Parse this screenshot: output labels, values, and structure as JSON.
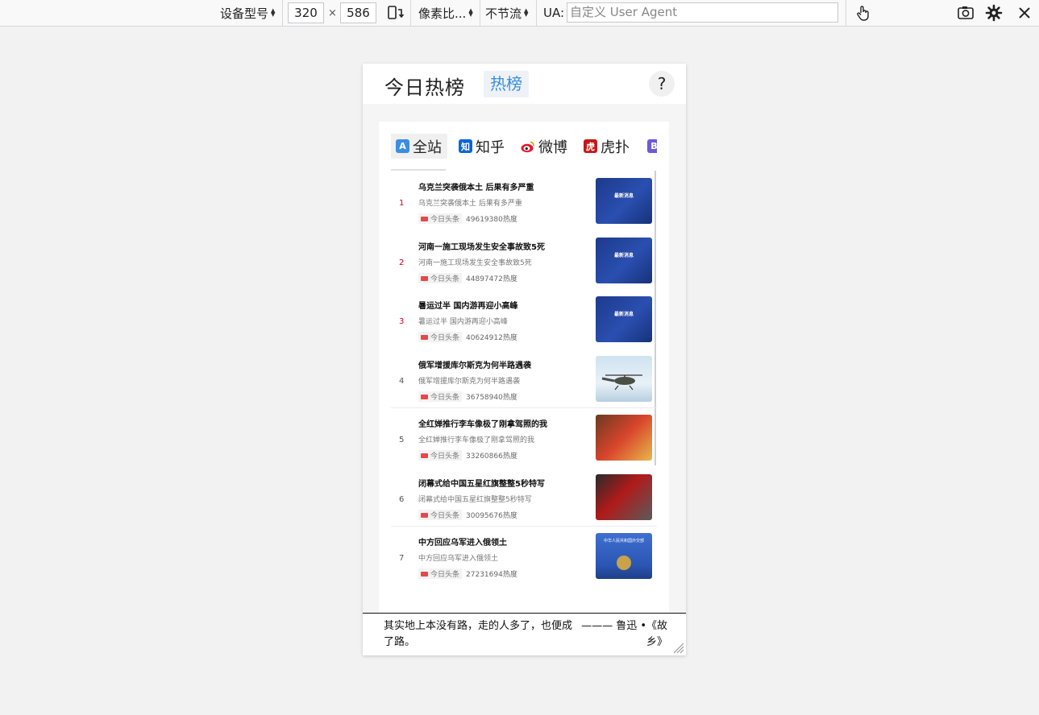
{
  "toolbar": {
    "device_select": "设备型号",
    "width": "320",
    "times": "×",
    "height": "586",
    "pixel_ratio": "像素比...",
    "throttle": "不节流",
    "ua_label": "UA:",
    "ua_placeholder": "自定义 User Agent"
  },
  "app": {
    "title": "今日热榜",
    "badge": "热榜",
    "help": "?"
  },
  "tabs": [
    {
      "label": "全站",
      "logo": "A",
      "color": "#3b8ee0"
    },
    {
      "label": "知乎",
      "logo": "知",
      "color": "#0a66d8"
    },
    {
      "label": "微博",
      "logo": "",
      "color": "#e6162d"
    },
    {
      "label": "虎扑",
      "logo": "虎",
      "color": "#c21a1a"
    },
    {
      "label": "",
      "logo": "B",
      "color": "#6b5bd6"
    }
  ],
  "items": [
    {
      "rank": "1",
      "title": "乌克兰突袭俄本土 后果有多严重",
      "desc": "乌克兰突袭俄本土 后果有多严重",
      "source": "今日头条",
      "heat": "49619380热度",
      "thumb_text": "最新消息"
    },
    {
      "rank": "2",
      "title": "河南一施工现场发生安全事故致5死",
      "desc": "河南一施工现场发生安全事故致5死",
      "source": "今日头条",
      "heat": "44897472热度",
      "thumb_text": "最新消息"
    },
    {
      "rank": "3",
      "title": "暑运过半 国内游再迎小高峰",
      "desc": "暑运过半 国内游再迎小高峰",
      "source": "今日头条",
      "heat": "40624912热度",
      "thumb_text": "最新消息"
    },
    {
      "rank": "4",
      "title": "俄军增援库尔斯克为何半路遇袭",
      "desc": "俄军增援库尔斯克为何半路遇袭",
      "source": "今日头条",
      "heat": "36758940热度",
      "thumb_text": ""
    },
    {
      "rank": "5",
      "title": "全红婵推行李车像极了刚拿驾照的我",
      "desc": "全红婵推行李车像极了刚拿驾照的我",
      "source": "今日头条",
      "heat": "33260866热度",
      "thumb_text": ""
    },
    {
      "rank": "6",
      "title": "闭幕式给中国五星红旗整整5秒特写",
      "desc": "闭幕式给中国五星红旗整整5秒特写",
      "source": "今日头条",
      "heat": "30095676热度",
      "thumb_text": ""
    },
    {
      "rank": "7",
      "title": "中方回应乌军进入俄领土",
      "desc": "中方回应乌军进入俄领土",
      "source": "今日头条",
      "heat": "27231694热度",
      "thumb_text": "中华人民共和国外交部"
    }
  ],
  "quote": {
    "text": "其实地上本没有路，走的人多了，也便成了路。",
    "author": "——— 鲁迅 •《故乡》"
  },
  "colors": {
    "rank_top": "#d0021b",
    "badge_text": "#3b8ee0",
    "source_logo": "#e8474b"
  }
}
